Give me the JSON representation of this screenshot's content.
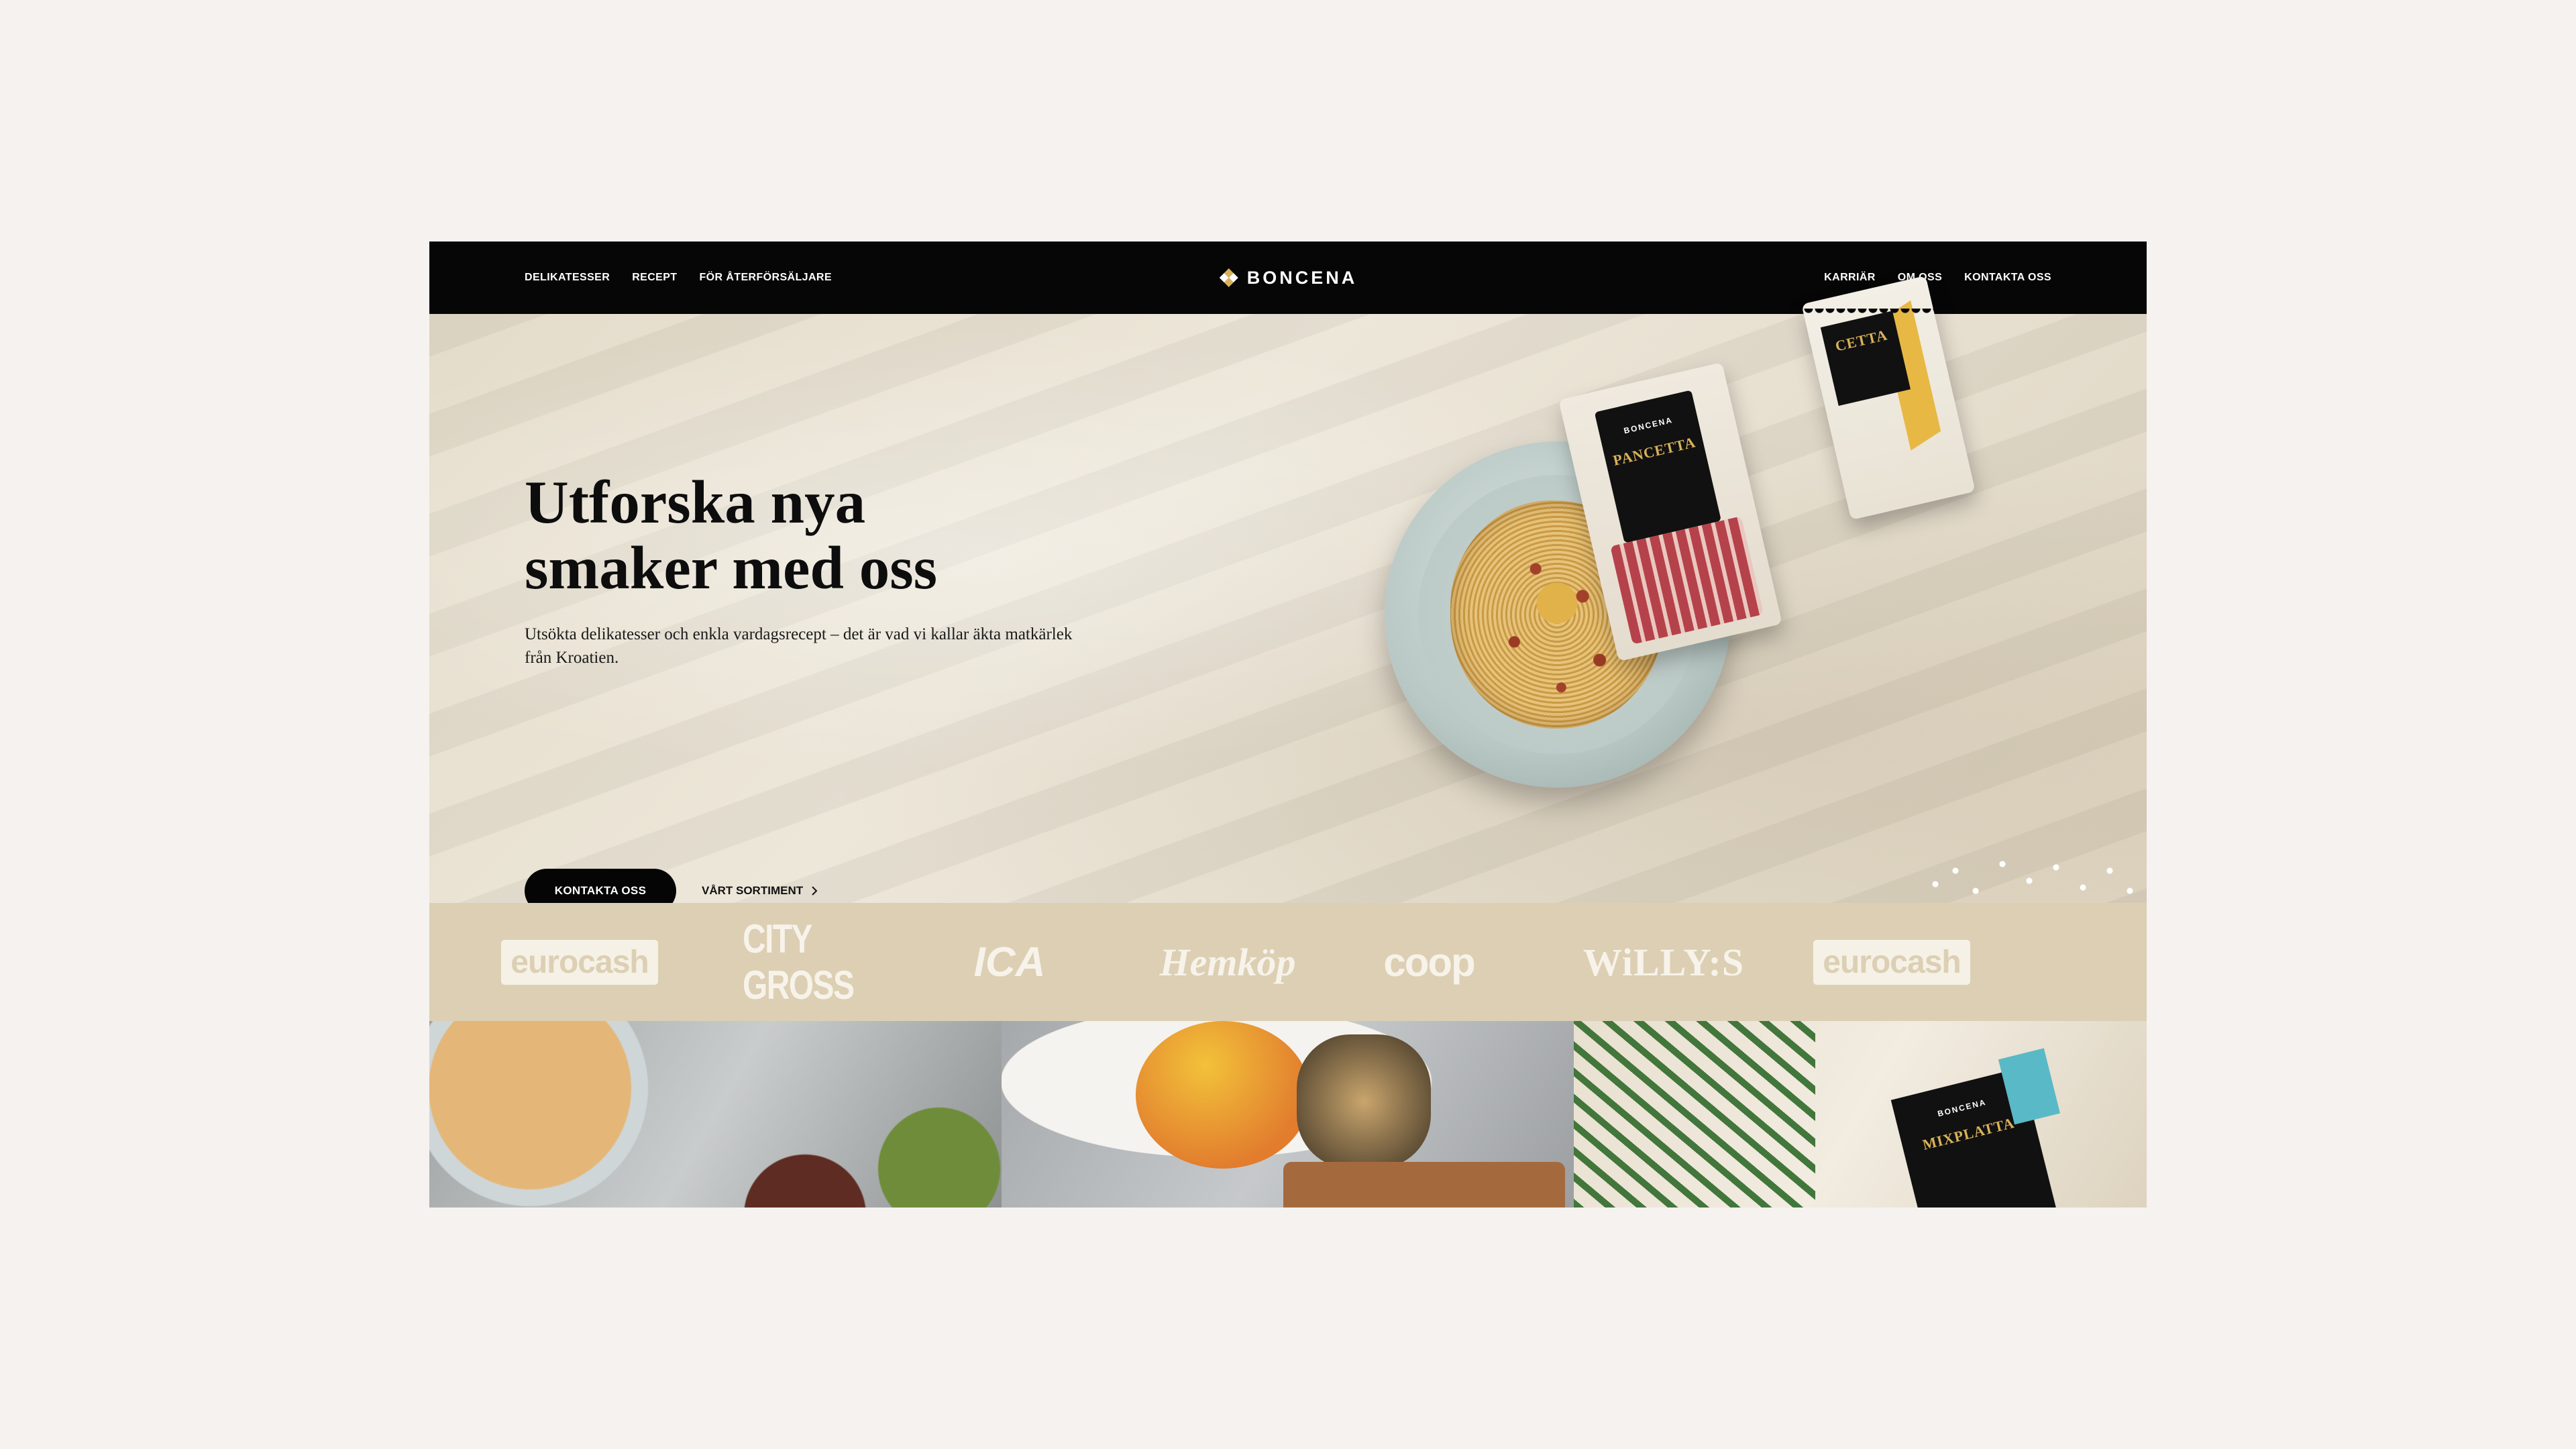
{
  "nav": {
    "left": [
      "DELIKATESSER",
      "RECEPT",
      "FÖR ÅTERFÖRSÄLJARE"
    ],
    "brand": "BONCENA",
    "right": [
      "KARRIÄR",
      "OM OSS",
      "KONTAKTA OSS"
    ]
  },
  "hero": {
    "title_line1": "Utforska nya",
    "title_line2": "smaker med oss",
    "subtitle": "Utsökta delikatesser och enkla vardagsrecept – det är vad vi kallar äkta matkärlek från Kroatien.",
    "primary_button": "KONTAKTA OSS",
    "secondary_link": "VÅRT SORTIMENT",
    "secondary_icon": "chevron-right-icon"
  },
  "products": {
    "pancetta_brand": "BONCENA",
    "pancetta_name": "PANCETTA",
    "second_name": "CETTA",
    "mix_brand": "BONCENA",
    "mix_name": "MIXPLATTA"
  },
  "retailers": [
    "eurocash",
    "CITY GROSS",
    "ICA",
    "Hemköp",
    "coop",
    "WiLLY:S",
    "eurocash"
  ],
  "colors": {
    "nav_bg": "#060606",
    "page_bg": "#f5f2f0",
    "retailer_band": "#dccfb3",
    "button_bg": "#050505",
    "accent_gold": "#d8b25a"
  }
}
